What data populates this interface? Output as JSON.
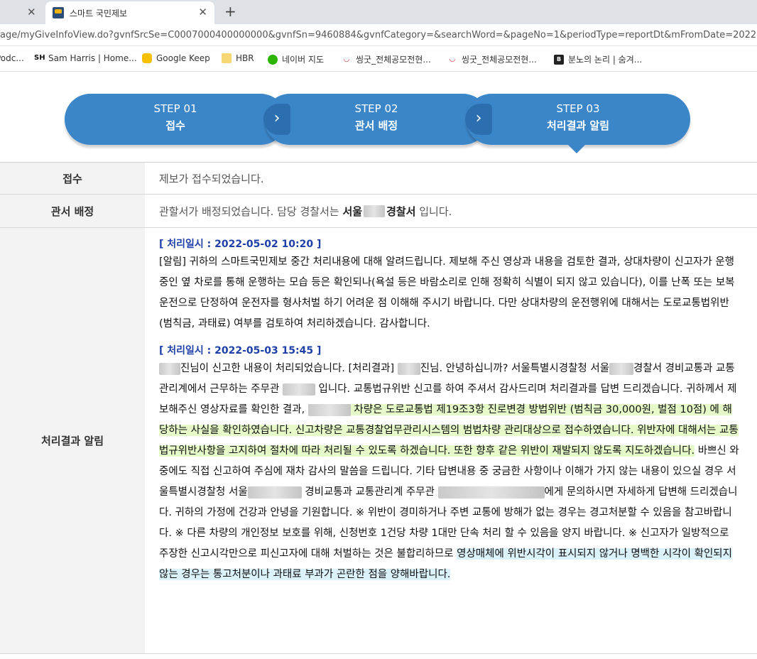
{
  "browser": {
    "tab_title": "스마트 국민제보",
    "url": "age/myGiveInfoView.do?gvnfSrcSe=C0007000400000000&gvnfSn=9460884&gvnfCategory=&searchWord=&pageNo=1&periodType=reportDt&mFromDate=2022-02-0",
    "bookmarks": [
      {
        "label": "Podc..."
      },
      {
        "label": "Sam Harris | Home..."
      },
      {
        "label": "Google Keep"
      },
      {
        "label": "HBR"
      },
      {
        "label": "네이버 지도"
      },
      {
        "label": "씽굿_전체공모전현..."
      },
      {
        "label": "씽굿_전체공모전현..."
      },
      {
        "label": "분노의 논리 | 숨겨..."
      }
    ]
  },
  "steps": [
    {
      "num": "STEP 01",
      "label": "접수"
    },
    {
      "num": "STEP 02",
      "label": "관서 배정"
    },
    {
      "num": "STEP 03",
      "label": "처리결과 알림"
    }
  ],
  "rows": {
    "received": {
      "header": "접수",
      "text": "제보가 접수되었습니다."
    },
    "assigned": {
      "header": "관서 배정",
      "text_a": "관할서가 배정되었습니다. 담당 경찰서는 ",
      "text_b": "서울",
      "text_c": "경찰서",
      "text_d": " 입니다."
    },
    "result": {
      "header": "처리결과 알림",
      "entry1": {
        "date": "[ 처리일시 : 2022-05-02 10:20 ]",
        "text": "[알림] 귀하의 스마트국민제보 중간 처리내용에 대해 알려드립니다. 제보해 주신 영상과 내용을 검토한 결과, 상대차량이 신고자가 운행중인 옆 차로를 통해 운행하는 모습 등은 확인되나(욕설 등은 바람소리로 인해 정확히 식별이 되지 않고 있습니다), 이를 난폭 또는 보복운전으로 단정하여 운전자를 형사처벌 하기 어려운 점 이해해 주시기 바랍니다. 다만 상대차량의 운전행위에 대해서는 도로교통법위반(범칙금, 과태료) 여부를 검토하여 처리하겠습니다. 감사합니다."
      },
      "entry2": {
        "date": "[ 처리일시 : 2022-05-03 15:45 ]",
        "p1": "진님이 신고한 내용이 처리되었습니다. [처리결과] ",
        "p2": "진님. 안녕하십니까? 서울특별시경찰청 서울",
        "p3": "경찰서 경비교통과 교통관리계에서 근무하는 주무관 ",
        "p4": " 입니다. 교통법규위반 신고를 하여 주셔서 감사드리며 처리결과를 답변 드리겠습니다. 귀하께서 제보해주신 영상자료를 확인한 결과, ",
        "hl1": " 차량은 도로교통법 제19조3항 진로변경 방법위반 (범칙금 30,000원, 벌점 10점) 에 해당하는 사실을 확인하였습니다. 신고차량은 교통경찰업무관리시스템의 범법차량 관리대상으로 접수하였습니다. 위반자에 대해서는 교통법규위반사항을 고지하여 절차에 따라 처리될 수 있도록 하겠습니다. 또한 향후 같은 위반이 재발되지 않도록 지도하겠습니다.",
        "p5": " 바쁘신 와중에도 직접 신고하여 주심에 재차 감사의 말씀을 드립니다. 기타 답변내용 중 궁금한 사항이나 이해가 가지 않는 내용이 있으실 경우 서울특별시경찰청 서울",
        "p6": " 경비교통과 교통관리계 주무관 ",
        "p7": "에게 문의하시면 자세하게 답변해 드리겠습니다. 귀하의 가정에 건강과 안녕을 기원합니다. ※ 위반이 경미하거나 주변 교통에 방해가 없는 경우는 경고처분할 수 있음을 참고바랍니다. ※ 다른 차량의 개인정보 보호를 위해, 신청번호 1건당 차량 1대만 단속 처리 할 수 있음을 양지 바랍니다. ※ 신고자가 일방적으로 주장한 신고시각만으로 피신고자에 대해 처벌하는 것은 불합리하므로 ",
        "hl2": "영상매체에 위반시각이 표시되지 않거나 명백한 시각이 확인되지 않는 경우는 통고처분이나 과태료 부과가 곤란한 점을 양해바랍니다."
      }
    }
  }
}
